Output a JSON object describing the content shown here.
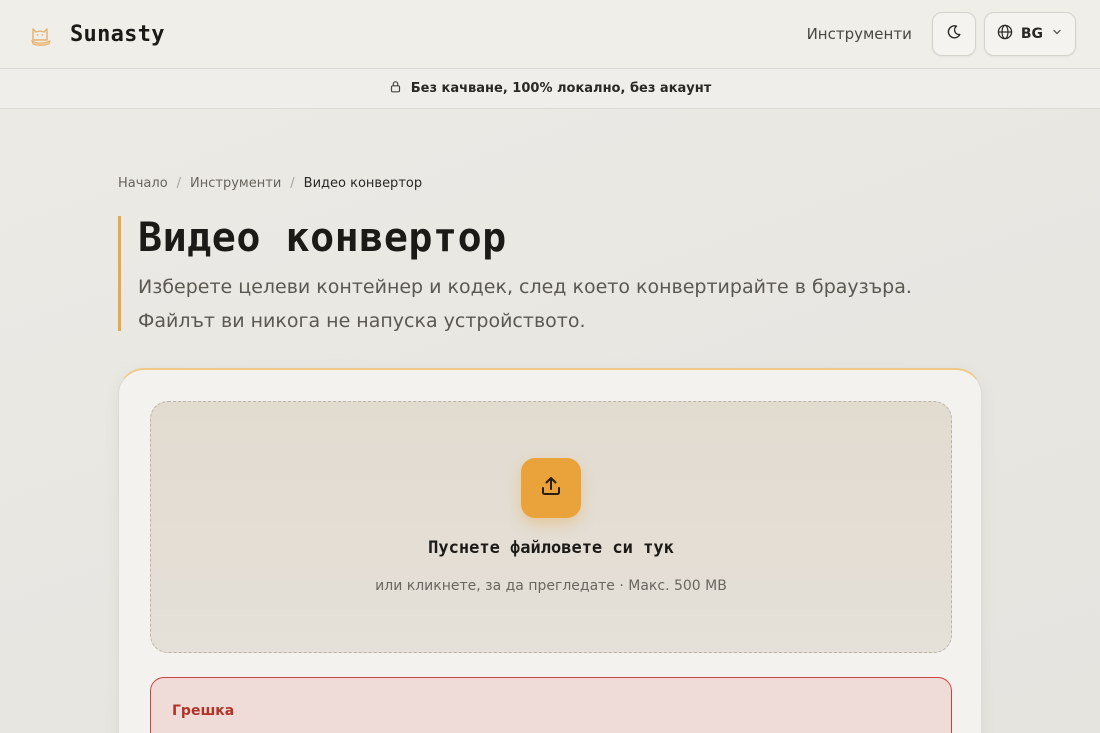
{
  "header": {
    "brand_name": "Sunasty",
    "logo_icon": "cat-logo-icon",
    "nav_tools": "Инструменти",
    "theme_icon": "moon-icon",
    "lang_icon": "globe-icon",
    "lang_label": "BG",
    "lang_chevron": "chevron-down-icon"
  },
  "privacy": {
    "icon": "lock-icon",
    "text": "Без качване, 100% локално, без акаунт"
  },
  "breadcrumb": {
    "home": "Начало",
    "tools": "Инструменти",
    "current": "Видео конвертор",
    "separator": "/"
  },
  "page": {
    "title": "Видео конвертор",
    "subtitle": "Изберете целеви контейнер и кодек, след което конвертирайте в браузъра. Файлът ви никога не напуска устройството."
  },
  "dropzone": {
    "icon": "upload-icon",
    "title": "Пуснете файловете си тук",
    "hint": "или кликнете, за да прегледате · Макс. 500 MB"
  },
  "error": {
    "title": "Грешка"
  },
  "colors": {
    "accent": "#e9a33a",
    "error": "#b03427",
    "background": "#e8e6e1"
  }
}
